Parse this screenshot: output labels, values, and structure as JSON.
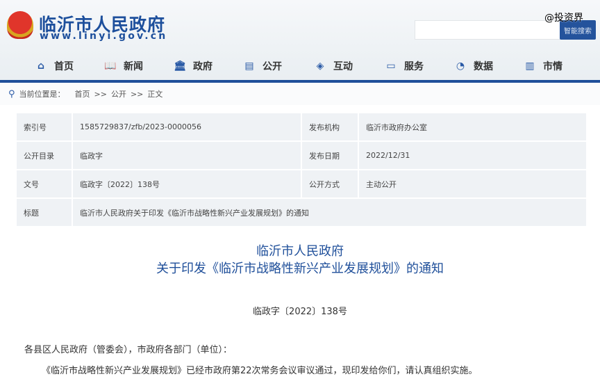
{
  "header": {
    "site_title": "临沂市人民政府",
    "site_url": "www.linyi.gov.cn",
    "search_placeholder": "",
    "search_button": "智能搜索",
    "watermark": "@投资界"
  },
  "nav": [
    {
      "label": "首页",
      "icon": "home-icon",
      "glyph": "⌂"
    },
    {
      "label": "新闻",
      "icon": "book-icon",
      "glyph": "📖"
    },
    {
      "label": "政府",
      "icon": "building-icon",
      "glyph": "🏛"
    },
    {
      "label": "公开",
      "icon": "document-icon",
      "glyph": "▤"
    },
    {
      "label": "互动",
      "icon": "handshake-icon",
      "glyph": "◈"
    },
    {
      "label": "服务",
      "icon": "chat-icon",
      "glyph": "▭"
    },
    {
      "label": "数据",
      "icon": "chart-icon",
      "glyph": "◔"
    },
    {
      "label": "市情",
      "icon": "city-icon",
      "glyph": "▥"
    }
  ],
  "breadcrumb": {
    "prefix": "当前位置是：",
    "items": [
      "首页",
      "公开",
      "正文"
    ],
    "sep": ">>"
  },
  "meta": {
    "index_label": "索引号",
    "index": "1585729837/zfb/2023-0000056",
    "org_label": "发布机构",
    "org": "临沂市政府办公室",
    "catalog_label": "公开目录",
    "catalog": "临政字",
    "date_label": "发布日期",
    "date": "2022/12/31",
    "docno_label": "文号",
    "docno": "临政字〔2022〕138号",
    "mode_label": "公开方式",
    "mode": "主动公开",
    "title_label": "标题",
    "title": "临沂市人民政府关于印发《临沂市战略性新兴产业发展规划》的通知"
  },
  "article": {
    "title1": "临沂市人民政府",
    "title2": "关于印发《临沂市战略性新兴产业发展规划》的通知",
    "docno": "临政字〔2022〕138号",
    "salutation": "各县区人民政府（管委会），市政府各部门（单位）：",
    "para1": "《临沂市战略性新兴产业发展规划》已经市政府第22次常务会议审议通过，现印发给你们，请认真组织实施。"
  }
}
